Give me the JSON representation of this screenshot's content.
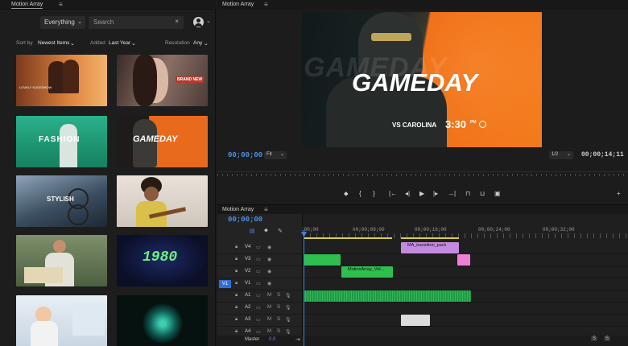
{
  "left_panel": {
    "tab_title": "Motion Array",
    "menu_icon": "hamburger-icon",
    "filter_dropdown": "Everything",
    "search_placeholder": "Search",
    "search_clear": "×",
    "filters": {
      "sort_label": "Sort by",
      "sort_value": "Newest Items",
      "added_label": "Added",
      "added_value": "Last Year",
      "resolution_label": "Resolution",
      "resolution_value": "Any"
    },
    "thumbnails": [
      {
        "text": "LOVELY SLIDESHOW",
        "bg": "#d9793a"
      },
      {
        "text": "BRAND NEW",
        "bg": "#6b5a52"
      },
      {
        "text": "FASHION",
        "bg": "#1f9f7c"
      },
      {
        "text": "GAMEDAY",
        "bg": "#e76a1f"
      },
      {
        "text": "STYLISH",
        "bg": "#3a4e60"
      },
      {
        "text": "",
        "bg": "#dfd7cf"
      },
      {
        "text": "",
        "bg": "#5e7c4f"
      },
      {
        "text": "1980",
        "bg": "#141a3a"
      },
      {
        "text": "",
        "bg": "#d6e2ee"
      },
      {
        "text": "",
        "bg": "#071410"
      }
    ]
  },
  "monitor": {
    "tab_title": "Motion Array",
    "video": {
      "headline": "GAMEDAY",
      "subline": "VS CAROLINA",
      "time": "3:30",
      "time_suffix": "PM",
      "bg_word": "GAMEDAY"
    },
    "current_tc": "00;00;00",
    "fit": "Fit",
    "quality": "1/2",
    "duration_tc": "00;00;14;11"
  },
  "timeline": {
    "tab_title": "Motion Array",
    "current_tc": "00;00;00",
    "ruler": [
      ":00;00",
      "00;00;08;00",
      "00;00;16;00",
      "00;00;24;00",
      "00;00;32;00"
    ],
    "tracks": [
      {
        "name": "V4",
        "kind": "video"
      },
      {
        "name": "V3",
        "kind": "video"
      },
      {
        "name": "V2",
        "kind": "video"
      },
      {
        "name": "V1",
        "kind": "video",
        "target": "V1"
      },
      {
        "name": "A1",
        "kind": "audio"
      },
      {
        "name": "A2",
        "kind": "audio"
      },
      {
        "name": "A3",
        "kind": "audio"
      },
      {
        "name": "A4",
        "kind": "audio"
      }
    ],
    "clip_labels": {
      "transition": "MA_transition_pack",
      "motion": "MotionArray_Vid..."
    },
    "master_label": "Master",
    "master_value": "0.0",
    "solo": "S"
  }
}
